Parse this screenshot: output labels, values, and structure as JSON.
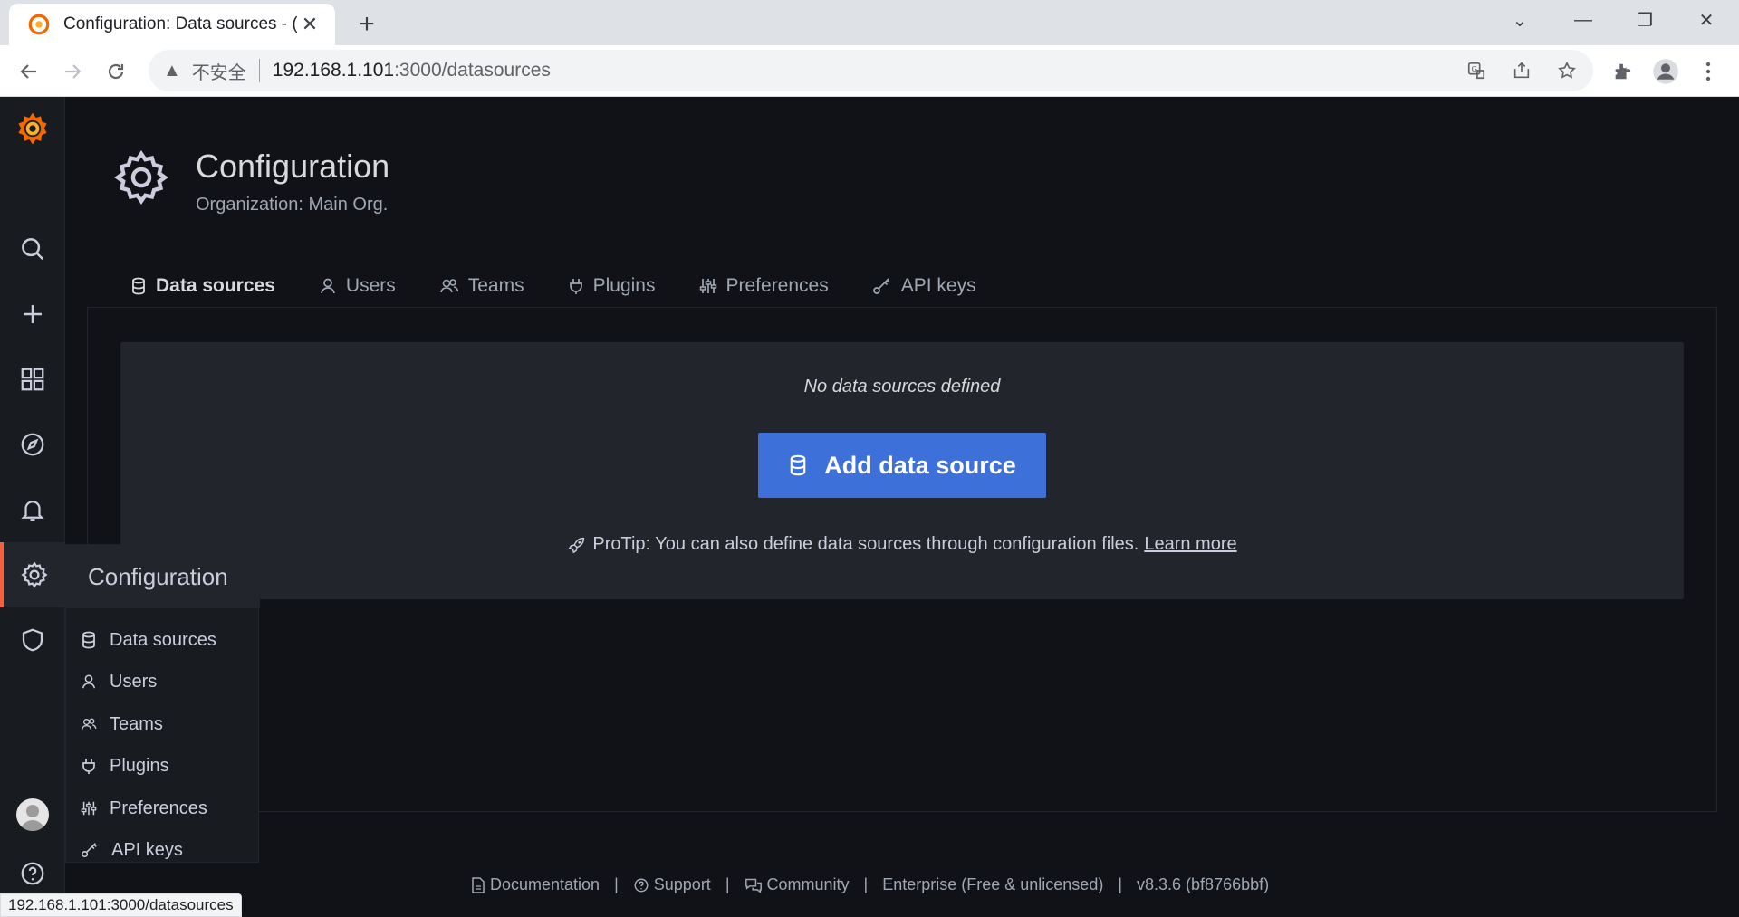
{
  "browser": {
    "tab_title": "Configuration: Data sources - Grafana",
    "tab_title_visible": "Configuration: Data sources - (",
    "security_label": "不安全",
    "url_host": "192.168.1.101",
    "url_path": ":3000/datasources",
    "status_url": "192.168.1.101:3000/datasources"
  },
  "page": {
    "title": "Configuration",
    "subtitle": "Organization: Main Org."
  },
  "tabs": [
    {
      "label": "Data sources",
      "icon": "database-icon",
      "active": true
    },
    {
      "label": "Users",
      "icon": "user-icon"
    },
    {
      "label": "Teams",
      "icon": "users-icon"
    },
    {
      "label": "Plugins",
      "icon": "plug-icon"
    },
    {
      "label": "Preferences",
      "icon": "sliders-icon"
    },
    {
      "label": "API keys",
      "icon": "key-icon"
    }
  ],
  "empty_state": {
    "message": "No data sources defined",
    "button_label": "Add data source",
    "protip": "ProTip: You can also define data sources through configuration files.",
    "learn_more": "Learn more"
  },
  "flyout": {
    "title": "Configuration",
    "items": [
      {
        "label": "Data sources",
        "icon": "database-icon"
      },
      {
        "label": "Users",
        "icon": "user-icon"
      },
      {
        "label": "Teams",
        "icon": "users-icon"
      },
      {
        "label": "Plugins",
        "icon": "plug-icon"
      },
      {
        "label": "Preferences",
        "icon": "sliders-icon"
      },
      {
        "label": "API keys",
        "icon": "key-icon"
      }
    ]
  },
  "footer": {
    "documentation": "Documentation",
    "support": "Support",
    "community": "Community",
    "edition": "Enterprise (Free & unlicensed)",
    "version": "v8.3.6 (bf8766bbf)",
    "separator": "|"
  },
  "colors": {
    "accent": "#3d71d9",
    "active_gradient_start": "#f2495c",
    "active_gradient_end": "#ff9830",
    "background": "#111217",
    "panel": "#22252b"
  }
}
